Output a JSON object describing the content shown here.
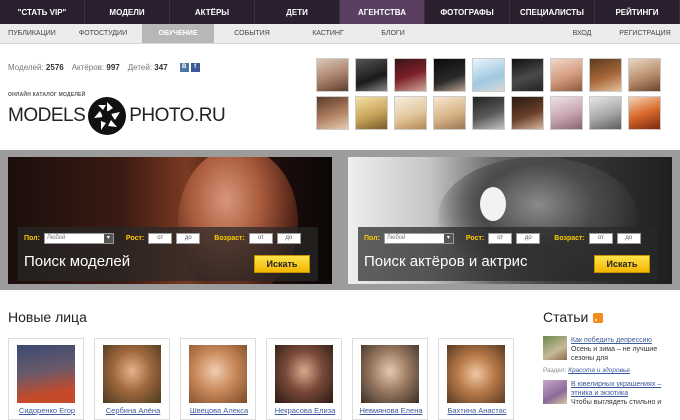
{
  "topnav": [
    "\"Стать VIP\"",
    "Модели",
    "Актёры",
    "Дети",
    "Агентства",
    "Фотографы",
    "Специалисты",
    "Рейтинги"
  ],
  "subnav": {
    "left": [
      "Публикации",
      "Фотостудии",
      "Обучение",
      "События",
      "Кастинг",
      "Блоги"
    ],
    "right": [
      "Вход",
      "Регистрация"
    ]
  },
  "stats": {
    "models_label": "Моделей:",
    "models_value": "2576",
    "actors_label": "Актёров:",
    "actors_value": "997",
    "kids_label": "Детей:",
    "kids_value": "347"
  },
  "logo": {
    "tagline": "ОНЛАЙН КАТАЛОГ МОДЕЛЕЙ",
    "left_word": "MODELS",
    "right_word": "PHOTO.RU"
  },
  "search": {
    "gender_label": "Пол:",
    "gender_value": "Любой",
    "height_label": "Рост:",
    "age_label": "Возраст:",
    "from_text": "от",
    "to_text": "до",
    "button": "Искать",
    "models_title": "Поиск моделей",
    "actors_title": "Поиск актёров и актрис"
  },
  "new_faces": {
    "title": "Новые лица",
    "items": [
      "Сидоренко Егор",
      "Сербина Алёна",
      "Швецова Алекса",
      "Некрасова Елиза",
      "Невмянова Елена",
      "Бахтина Анастас"
    ]
  },
  "articles": {
    "title": "Статьи",
    "items": [
      {
        "link": "Как победить депрессию",
        "text": "Осень и зима – не лучшие сезоны для"
      },
      {
        "link": "В ювелирных украшениях – этника и экзотика",
        "text": "Чтобы выглядеть стильно и"
      }
    ],
    "section_label": "Раздел:",
    "section_link": "Красота и здоровье"
  },
  "colors": {
    "topnav": "#2a1f2e",
    "accent_yellow": "#ffcc00",
    "link": "#3b5a9c"
  }
}
